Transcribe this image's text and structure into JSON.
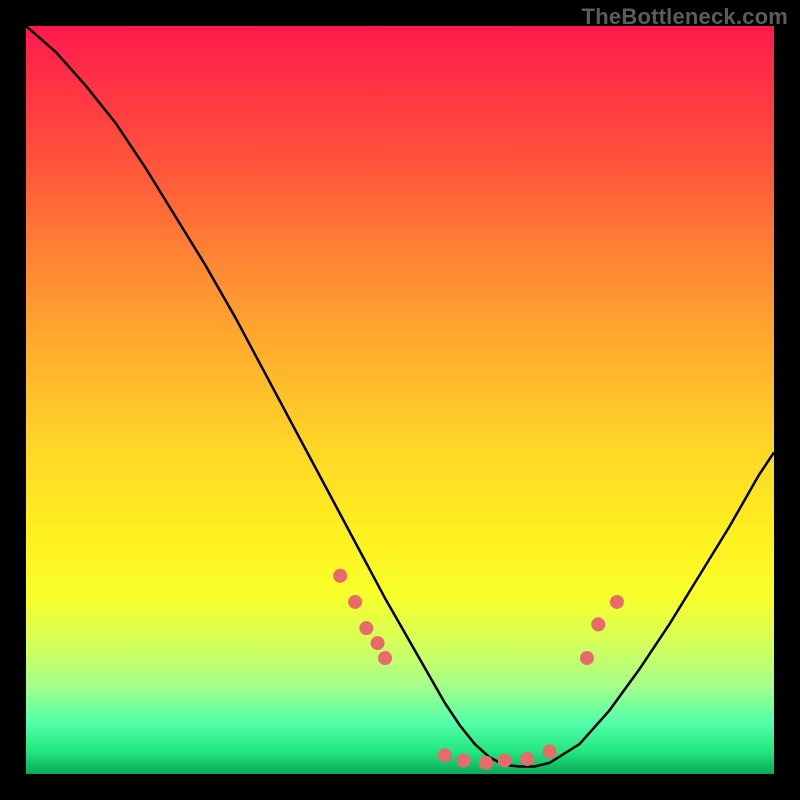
{
  "watermark": "TheBottleneck.com",
  "chart_data": {
    "type": "line",
    "title": "",
    "xlabel": "",
    "ylabel": "",
    "xlim": [
      0,
      100
    ],
    "ylim": [
      0,
      100
    ],
    "grid": false,
    "series": [
      {
        "name": "bottleneck-curve",
        "x": [
          0,
          4,
          8,
          12,
          16,
          20,
          24,
          28,
          32,
          36,
          40,
          44,
          48,
          52,
          56,
          58,
          60,
          62,
          64,
          66,
          68,
          70,
          74,
          78,
          82,
          86,
          90,
          94,
          98,
          100
        ],
        "y": [
          100,
          96.5,
          92,
          87,
          81,
          74.5,
          68,
          61,
          53.5,
          46,
          38.5,
          31,
          23.5,
          16.5,
          9.5,
          6.5,
          4,
          2.2,
          1.2,
          1,
          1,
          1.5,
          4,
          8.5,
          14,
          20,
          26.5,
          33,
          40,
          43
        ],
        "color": "#000000"
      }
    ],
    "points": {
      "name": "highlighted-points",
      "color": "#e86a6a",
      "radius_px": 7,
      "x": [
        42,
        44,
        45.5,
        47,
        48,
        56,
        58.5,
        61.5,
        64,
        67,
        70,
        75,
        76.5,
        79
      ],
      "y": [
        26.5,
        23,
        19.5,
        17.5,
        15.5,
        2.5,
        1.8,
        1.5,
        1.8,
        2,
        3,
        15.5,
        20,
        23
      ]
    }
  }
}
